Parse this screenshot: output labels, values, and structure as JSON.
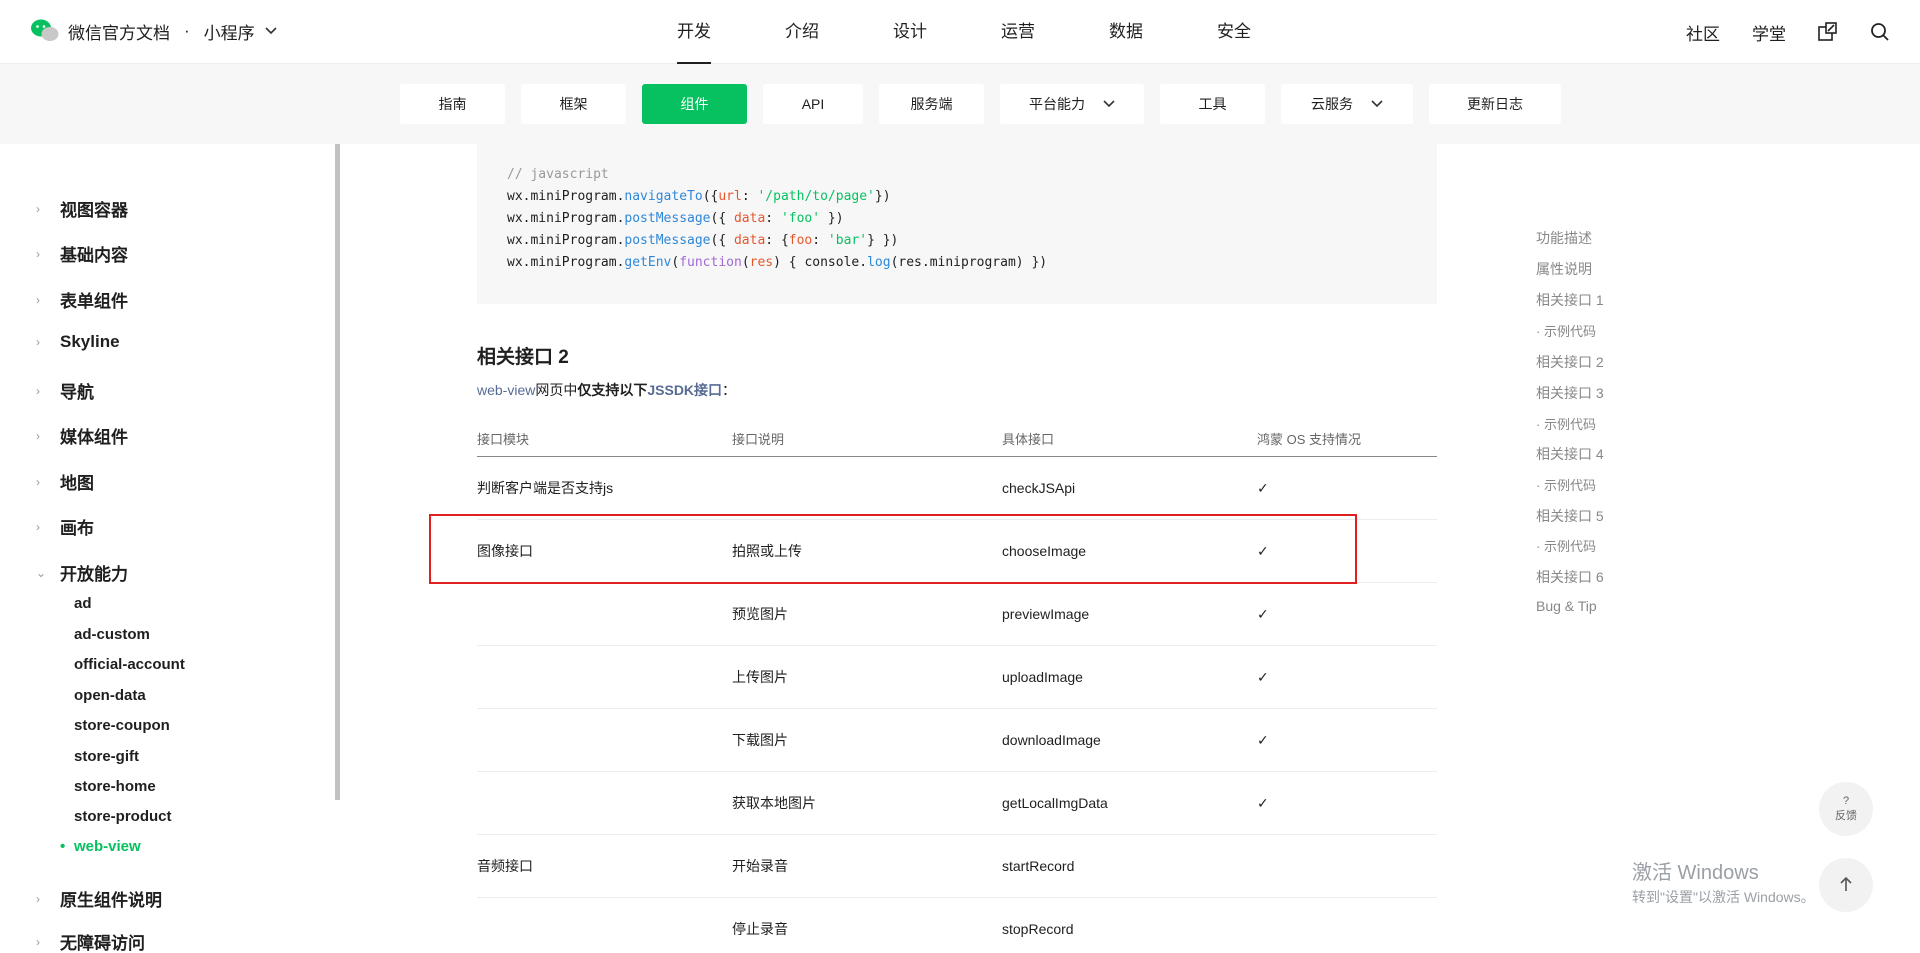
{
  "header": {
    "brand": "微信官方文档",
    "section": "小程序",
    "nav": [
      "开发",
      "介绍",
      "设计",
      "运营",
      "数据",
      "安全"
    ],
    "active_nav": "开发",
    "community": "社区",
    "academy": "学堂"
  },
  "subnav": {
    "tabs": [
      {
        "label": "指南",
        "dropdown": false
      },
      {
        "label": "框架",
        "dropdown": false
      },
      {
        "label": "组件",
        "dropdown": false,
        "active": true
      },
      {
        "label": "API",
        "dropdown": false
      },
      {
        "label": "服务端",
        "dropdown": false
      },
      {
        "label": "平台能力",
        "dropdown": true
      },
      {
        "label": "工具",
        "dropdown": false
      },
      {
        "label": "云服务",
        "dropdown": true
      },
      {
        "label": "更新日志",
        "dropdown": false
      }
    ]
  },
  "sidebar": {
    "groups": [
      "视图容器",
      "基础内容",
      "表单组件",
      "Skyline",
      "导航",
      "媒体组件",
      "地图",
      "画布",
      "开放能力"
    ],
    "open_items": [
      "ad",
      "ad-custom",
      "official-account",
      "open-data",
      "store-coupon",
      "store-gift",
      "store-home",
      "store-product",
      "web-view"
    ],
    "active_item": "web-view",
    "after_groups": [
      "原生组件说明",
      "无障碍访问"
    ]
  },
  "code": {
    "comment": "// javascript",
    "line1_obj": "wx.miniProgram.",
    "line1_fn": "navigateTo",
    "line1_rest": "({url: '/path/to/page'})",
    "line2_fn": "postMessage",
    "line2_rest": "({ data: 'foo' })",
    "line3_rest": "({ data: {foo: 'bar'} })",
    "line4_fn": "getEnv",
    "line4_kw": "function",
    "line4_param": "res",
    "line4_body": "{ console.",
    "line4_log": "log",
    "line4_end": "(res.miniprogram) })"
  },
  "section": {
    "title": "相关接口 2",
    "intro_link": "web-view",
    "intro_text": "网页中",
    "intro_bold": "仅支持以下",
    "intro_link2": "JSSDK接口",
    "intro_end": "："
  },
  "table": {
    "headers": [
      "接口模块",
      "接口说明",
      "具体接口",
      "鸿蒙 OS 支持情况"
    ],
    "rows": [
      [
        "判断客户端是否支持js",
        "",
        "checkJSApi",
        "✓"
      ],
      [
        "图像接口",
        "拍照或上传",
        "chooseImage",
        "✓"
      ],
      [
        "",
        "预览图片",
        "previewImage",
        "✓"
      ],
      [
        "",
        "上传图片",
        "uploadImage",
        "✓"
      ],
      [
        "",
        "下载图片",
        "downloadImage",
        "✓"
      ],
      [
        "",
        "获取本地图片",
        "getLocalImgData",
        "✓"
      ],
      [
        "音频接口",
        "开始录音",
        "startRecord",
        ""
      ],
      [
        "",
        "停止录音",
        "stopRecord",
        ""
      ]
    ]
  },
  "toc": [
    "功能描述",
    "属性说明",
    "相关接口 1",
    "· 示例代码",
    "相关接口 2",
    "相关接口 3",
    "· 示例代码",
    "相关接口 4",
    "· 示例代码",
    "相关接口 5",
    "· 示例代码",
    "相关接口 6",
    "Bug & Tip"
  ],
  "float": {
    "feedback_q": "?",
    "feedback": "反馈"
  },
  "watermark": {
    "line1": "激活 Windows",
    "line2": "转到\"设置\"以激活 Windows。"
  }
}
